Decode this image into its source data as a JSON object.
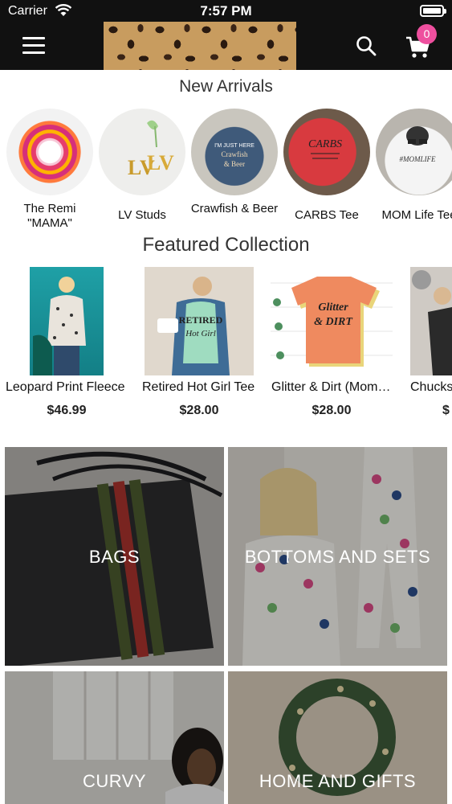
{
  "status": {
    "carrier": "Carrier",
    "time": "7:57 PM"
  },
  "header": {
    "cart_count": "0"
  },
  "new_arrivals": {
    "title": "New Arrivals",
    "items": [
      {
        "label": "The Remi \"MAMA\""
      },
      {
        "label": "LV Studs"
      },
      {
        "label": "Crawfish & Beer"
      },
      {
        "label": "CARBS Tee"
      },
      {
        "label": "MOM Life Tee"
      }
    ]
  },
  "featured": {
    "title": "Featured Collection",
    "items": [
      {
        "name": "Leopard Print Fleece",
        "price": "$46.99"
      },
      {
        "name": "Retired Hot Girl Tee",
        "price": "$28.00"
      },
      {
        "name": "Glitter & Dirt (Mom…",
        "price": "$28.00"
      },
      {
        "name": "Chucks",
        "price": "$"
      }
    ]
  },
  "categories": [
    {
      "label": "BAGS"
    },
    {
      "label": "BOTTOMS AND SETS"
    },
    {
      "label": "CURVY"
    },
    {
      "label": "HOME AND GIFTS"
    }
  ],
  "colors": {
    "header_bg": "#111111",
    "badge": "#ee4f9e"
  }
}
